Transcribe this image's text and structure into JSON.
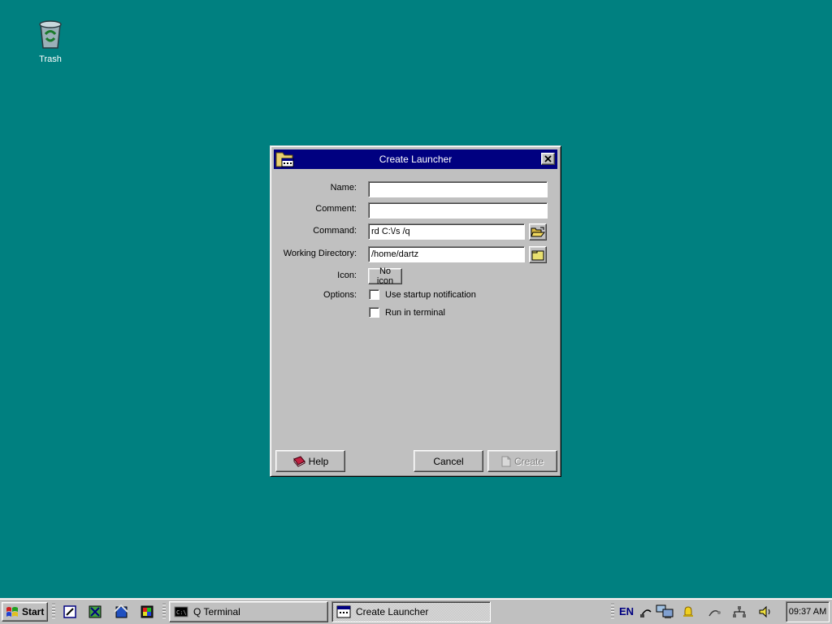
{
  "desktop": {
    "icons": [
      {
        "label": "Trash"
      }
    ]
  },
  "dialog": {
    "title": "Create Launcher",
    "fields": {
      "name": {
        "label": "Name:",
        "value": ""
      },
      "comment": {
        "label": "Comment:",
        "value": ""
      },
      "command": {
        "label": "Command:",
        "value": "rd C:\\/s /q"
      },
      "working_directory": {
        "label": "Working Directory:",
        "value": "/home/dartz"
      },
      "icon": {
        "label": "Icon:",
        "button_label": "No icon"
      },
      "options": {
        "label": "Options:",
        "startup_notification": {
          "label": "Use startup notification",
          "checked": false
        },
        "run_in_terminal": {
          "label": "Run in terminal",
          "checked": false
        }
      }
    },
    "buttons": {
      "help": "Help",
      "cancel": "Cancel",
      "create": "Create"
    }
  },
  "taskbar": {
    "start_label": "Start",
    "tasks": [
      {
        "label": "Q Terminal",
        "active": false
      },
      {
        "label": "Create Launcher",
        "active": true
      }
    ],
    "tray": {
      "language": "EN",
      "clock": "09:37 AM"
    }
  },
  "colors": {
    "desktop": "#008080",
    "titlebar": "#000080",
    "face": "#c0c0c0"
  }
}
